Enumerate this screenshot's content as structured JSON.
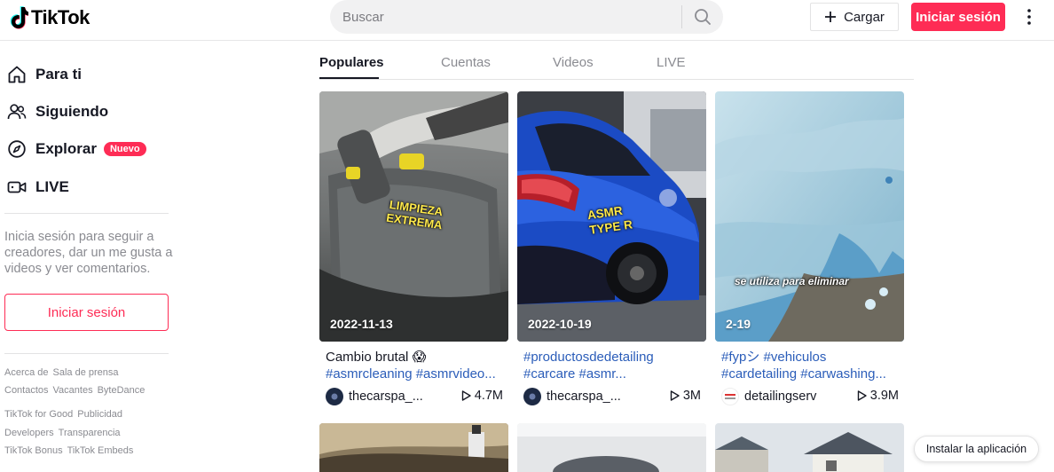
{
  "header": {
    "logo_text": "TikTok",
    "search_placeholder": "Buscar",
    "upload_label": "Cargar",
    "login_label": "Iniciar sesión"
  },
  "sidebar": {
    "nav": [
      {
        "label": "Para ti",
        "icon": "home-icon"
      },
      {
        "label": "Siguiendo",
        "icon": "following-icon"
      },
      {
        "label": "Explorar",
        "icon": "compass-icon",
        "badge": "Nuevo"
      },
      {
        "label": "LIVE",
        "icon": "live-icon"
      }
    ],
    "login_prompt": "Inicia sesión para seguir a creadores, dar un me gusta a videos y ver comentarios.",
    "login_label": "Iniciar sesión",
    "footer_links": [
      [
        "Acerca de",
        "Sala de prensa"
      ],
      [
        "Contactos",
        "Vacantes",
        "ByteDance"
      ],
      [
        "TikTok for Good",
        "Publicidad"
      ],
      [
        "Developers",
        "Transparencia"
      ],
      [
        "TikTok Bonus",
        "TikTok Embeds"
      ]
    ]
  },
  "tabs": [
    "Populares",
    "Cuentas",
    "Videos",
    "LIVE"
  ],
  "active_tab": "Populares",
  "cards": [
    {
      "date": "2022-11-13",
      "overlay": "LIMPIEZA EXTREMA",
      "title": "Cambio brutal",
      "emoji": "😱",
      "tags": "#asmrcleaning #asmrvideo...",
      "user": "thecarspa_...",
      "views": "4.7M"
    },
    {
      "date": "2022-10-19",
      "overlay": "ASMR TYPE R",
      "title": "#productosdedetailing",
      "tags": "#carcare #asmr...",
      "user": "thecarspa_...",
      "views": "3M"
    },
    {
      "date": "2-19",
      "overlay": "se utiliza para eliminar",
      "title": "#fypシ #vehiculos",
      "tags": "#cardetailing #carwashing...",
      "user": "detailingserv",
      "views": "3.9M"
    }
  ],
  "install_label": "Instalar la aplicación",
  "colors": {
    "brand": "#fe2c55",
    "hashtag": "#2b5db9",
    "text": "#161823",
    "muted": "#8a8b91"
  }
}
